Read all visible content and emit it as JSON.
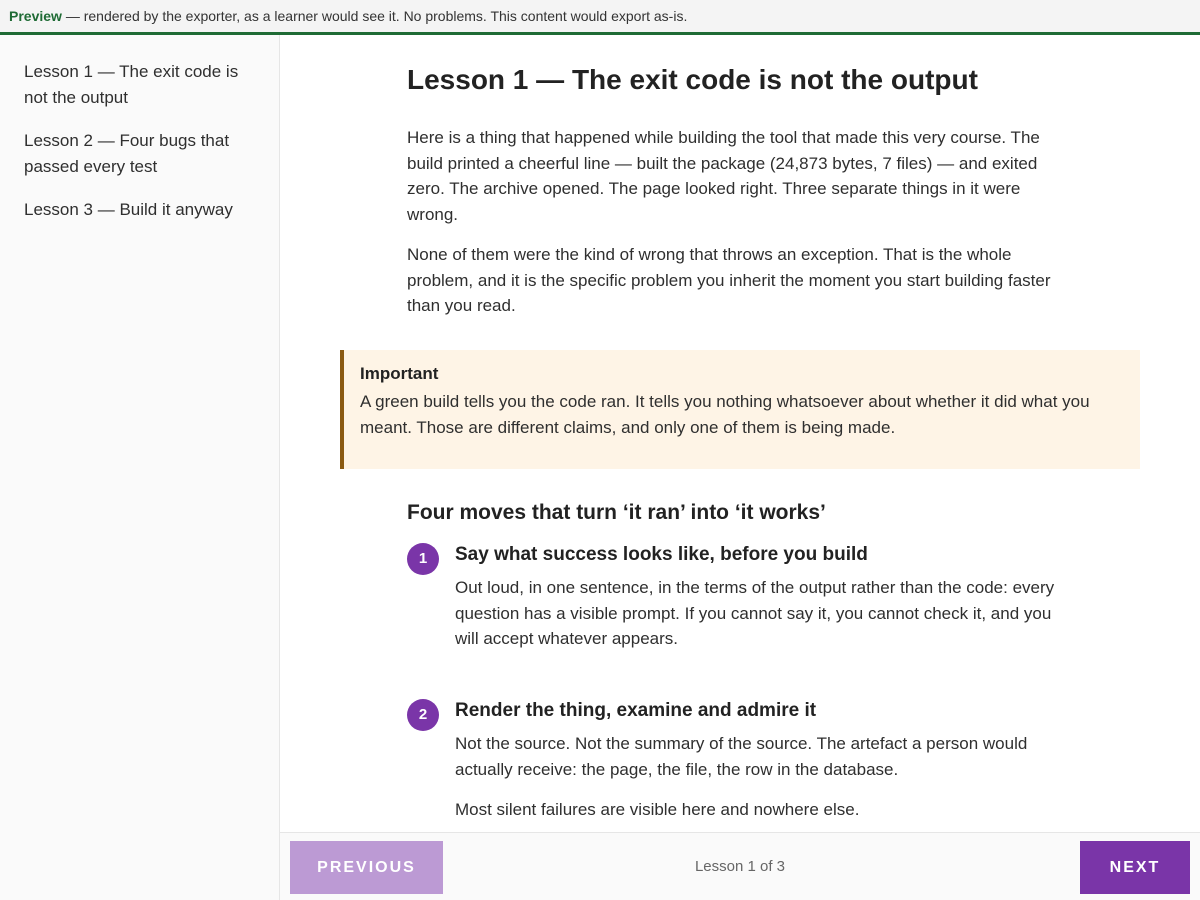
{
  "preview_bar": {
    "tag": "Preview",
    "message": " — rendered by the exporter, as a learner would see it. No problems. This content would export as-is."
  },
  "sidebar": {
    "items": [
      {
        "label": "Lesson 1 — The exit code is not the output"
      },
      {
        "label": "Lesson 2 — Four bugs that passed every test"
      },
      {
        "label": "Lesson 3 — Build it anyway"
      }
    ]
  },
  "lesson": {
    "title": "Lesson 1 — The exit code is not the output",
    "paragraphs": [
      "Here is a thing that happened while building the tool that made this very course. The build printed a cheerful line — built the package (24,873 bytes, 7 files) — and exited zero. The archive opened. The page looked right. Three separate things in it were wrong.",
      "None of them were the kind of wrong that throws an exception. That is the whole problem, and it is the specific problem you inherit the moment you start building faster than you read."
    ],
    "callout": {
      "title": "Important",
      "body": "A green build tells you the code ran. It tells you nothing whatsoever about whether it did what you meant. Those are different claims, and only one of them is being made."
    },
    "section_title": "Four moves that turn ‘it ran’ into ‘it works’",
    "steps": [
      {
        "number": "1",
        "title": "Say what success looks like, before you build",
        "paragraphs": [
          "Out loud, in one sentence, in the terms of the output rather than the code: every question has a visible prompt. If you cannot say it, you cannot check it, and you will accept whatever appears."
        ]
      },
      {
        "number": "2",
        "title": "Render the thing, examine and admire it",
        "paragraphs": [
          "Not the source. Not the summary of the source. The artefact a person would actually receive: the page, the file, the row in the database.",
          "Most silent failures are visible here and nowhere else."
        ]
      }
    ]
  },
  "footer": {
    "previous_label": "PREVIOUS",
    "next_label": "NEXT",
    "progress": "Lesson 1 of 3"
  }
}
